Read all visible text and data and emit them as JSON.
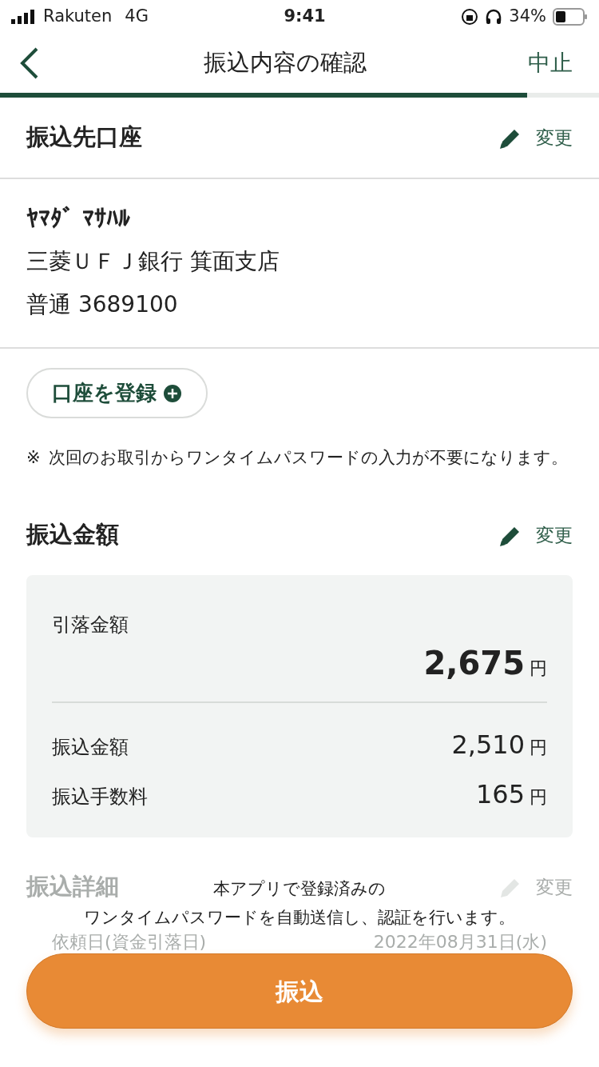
{
  "status_bar": {
    "carrier": "Rakuten",
    "network": "4G",
    "time": "9:41",
    "battery": "34%"
  },
  "nav": {
    "title": "振込内容の確認",
    "cancel": "中止"
  },
  "progress": {
    "level": 0.88
  },
  "payee": {
    "title": "振込先口座",
    "edit": "変更",
    "name": "ﾔﾏﾀﾞ ﾏｻﾊﾙ",
    "bank": "三菱ＵＦＪ銀行 箕面支店",
    "account": "普通 3689100"
  },
  "register": {
    "label": "口座を登録",
    "note_mark": "※",
    "note": "次回のお取引からワンタイムパスワードの入力が不要になります。"
  },
  "amount": {
    "title": "振込金額",
    "edit": "変更",
    "total_label": "引落金額",
    "total": "2,675",
    "total_unit": "円",
    "rows": [
      {
        "label": "振込金額",
        "value": "2,510",
        "unit": "円"
      },
      {
        "label": "振込手数料",
        "value": "165",
        "unit": "円"
      }
    ]
  },
  "details": {
    "title": "振込詳細",
    "edit": "変更",
    "rows": [
      {
        "label": "依頼日(資金引落日)",
        "value": "2022年08月31日(水)"
      }
    ]
  },
  "footer": {
    "notice": [
      "本アプリで登録済みの",
      "ワンタイムパスワードを自動送信し、認証を行います。"
    ],
    "button": "振込"
  }
}
